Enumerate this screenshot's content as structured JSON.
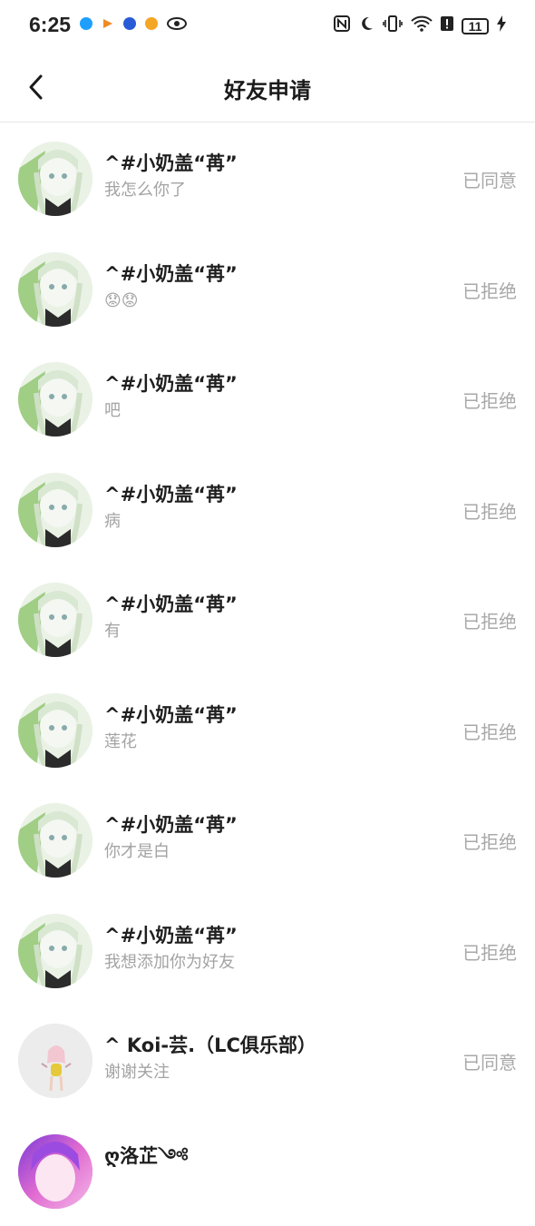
{
  "status_bar": {
    "time": "6:25",
    "battery": "11",
    "app_icons": [
      "qq-icon",
      "bilibili-icon",
      "browser-icon",
      "music-icon",
      "eye-icon"
    ],
    "right_icons": [
      "nfc-icon",
      "moon-icon",
      "vibrate-icon",
      "wifi-icon",
      "alert-icon",
      "battery-icon",
      "charging-icon"
    ]
  },
  "header": {
    "title": "好友申请"
  },
  "requests": [
    {
      "name": "^#小奶盖“苒”",
      "message": "我怎么你了",
      "status": "已同意",
      "avatar": "anime-girl"
    },
    {
      "name": "^#小奶盖“苒”",
      "message": "😟😟",
      "status": "已拒绝",
      "avatar": "anime-girl"
    },
    {
      "name": "^#小奶盖“苒”",
      "message": "吧",
      "status": "已拒绝",
      "avatar": "anime-girl"
    },
    {
      "name": "^#小奶盖“苒”",
      "message": "病",
      "status": "已拒绝",
      "avatar": "anime-girl"
    },
    {
      "name": "^#小奶盖“苒”",
      "message": "有",
      "status": "已拒绝",
      "avatar": "anime-girl"
    },
    {
      "name": "^#小奶盖“苒”",
      "message": "莲花",
      "status": "已拒绝",
      "avatar": "anime-girl"
    },
    {
      "name": "^#小奶盖“苒”",
      "message": "你才是白",
      "status": "已拒绝",
      "avatar": "anime-girl"
    },
    {
      "name": "^#小奶盖“苒”",
      "message": "我想添加你为好友",
      "status": "已拒绝",
      "avatar": "anime-girl"
    },
    {
      "name": "^ Koi-芸.（LC俱乐部）",
      "message": "谢谢关注",
      "status": "已同意",
      "avatar": "chibi-figure"
    },
    {
      "name": "ღ洛芷༺",
      "message": "",
      "status": "",
      "avatar": "pink-anime"
    }
  ],
  "colors": {
    "name": "#1f1f1f",
    "message": "#a3a3a3",
    "status": "#a8a8a8",
    "divider": "#e6e6e6"
  }
}
